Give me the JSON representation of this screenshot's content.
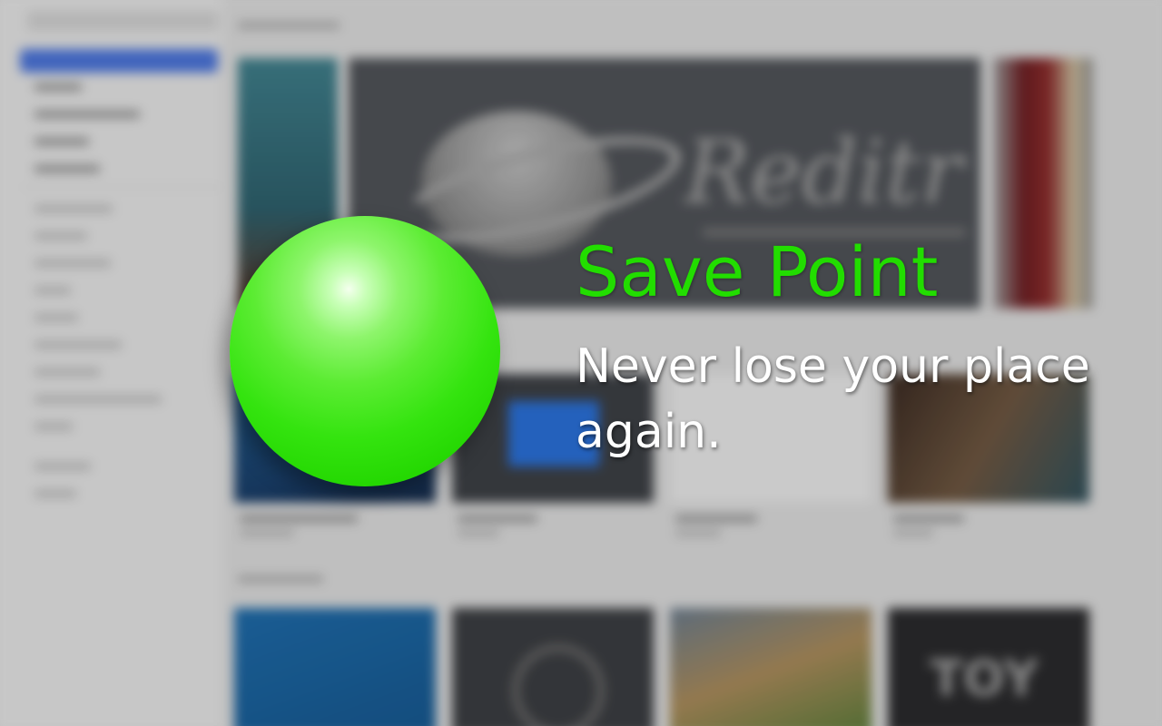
{
  "promo": {
    "title": "Save Point",
    "tagline": "Never lose your place again."
  },
  "colors": {
    "title": "#22dd00",
    "orb": "#2ee000",
    "tagline": "#ffffff"
  },
  "background": {
    "banner_text": "Reditr",
    "row_tile_text": "TOY"
  }
}
